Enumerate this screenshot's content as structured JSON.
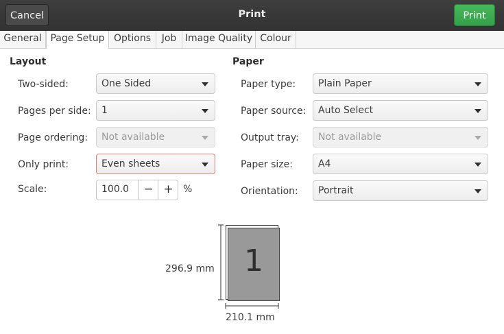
{
  "header": {
    "cancel_label": "Cancel",
    "title": "Print",
    "print_label": "Print"
  },
  "tabs": [
    "General",
    "Page Setup",
    "Options",
    "Job",
    "Image Quality",
    "Colour"
  ],
  "layout": {
    "title": "Layout",
    "two_sided": {
      "label": "Two-sided:",
      "value": "One Sided"
    },
    "pages_per_side": {
      "label": "Pages per side:",
      "value": "1"
    },
    "page_ordering": {
      "label": "Page ordering:",
      "value": "Not available"
    },
    "only_print": {
      "label": "Only print:",
      "value": "Even sheets"
    },
    "scale": {
      "label": "Scale:",
      "value": "100.0",
      "minus": "−",
      "plus": "+",
      "unit": "%"
    }
  },
  "paper": {
    "title": "Paper",
    "paper_type": {
      "label": "Paper type:",
      "value": "Plain Paper"
    },
    "paper_source": {
      "label": "Paper source:",
      "value": "Auto Select"
    },
    "output_tray": {
      "label": "Output tray:",
      "value": "Not available"
    },
    "paper_size": {
      "label": "Paper size:",
      "value": "A4"
    },
    "orientation": {
      "label": "Orientation:",
      "value": "Portrait"
    }
  },
  "preview": {
    "height_label": "296.9 mm",
    "width_label": "210.1 mm",
    "page_number": "1"
  },
  "colors": {
    "print_button": "#3aa64c",
    "header": "#383838",
    "page_preview": "#999999"
  }
}
